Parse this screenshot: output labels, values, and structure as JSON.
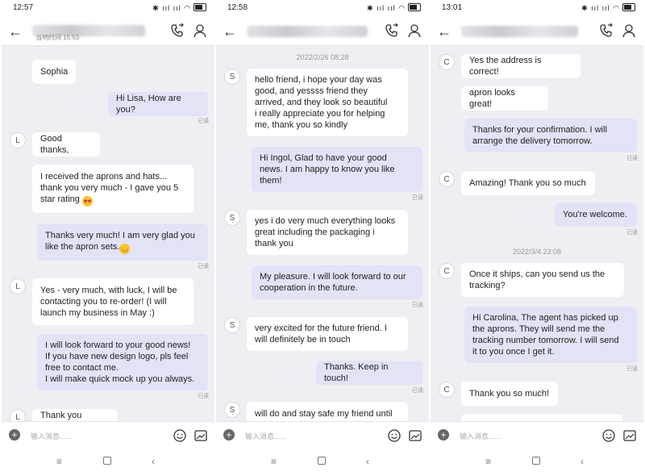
{
  "input_placeholder": "输入消息......",
  "read_label": "已读",
  "screens": [
    {
      "time": "12:57",
      "header_subtitle": "当地时间 15:53",
      "messages": [
        {
          "dir": "in",
          "text": "Sophia",
          "avatar": ""
        },
        {
          "dir": "out",
          "text": "Hi Lisa, How are you?",
          "read": true
        },
        {
          "dir": "in",
          "text": "Good thanks,",
          "avatar": "L"
        },
        {
          "dir": "in",
          "text": "I received the aprons and hats...\nthank you very much - I gave you 5\nstar rating",
          "emoji": "heart-eyes"
        },
        {
          "dir": "out",
          "text": "Thanks very much! I am very glad you\nlike the apron sets.",
          "emoji": "smile",
          "read": true
        },
        {
          "dir": "in",
          "text": "Yes - very much, with luck, I will be\ncontacting you to re-order! (I will\nlaunch my business in May :)",
          "avatar": "L"
        },
        {
          "dir": "out",
          "text": "I will look forward to your good news!\nIf you have new design logo, pls feel\nfree to contact me.\nI will make quick mock up you always.",
          "read": true
        },
        {
          "dir": "in",
          "text": "Thank you again!!",
          "avatar": "L"
        }
      ]
    },
    {
      "time": "12:58",
      "datetime": "2022/2/26 08:28",
      "messages": [
        {
          "dir": "in",
          "text": "hello friend, i hope your day was\ngood, and yessss friend they\narrived, and they look so beautiful\ni really appreciate you for helping\nme, thank you so kindly",
          "avatar": "S"
        },
        {
          "dir": "out",
          "text": "Hi Ingol, Glad to have your good\nnews. I am happy to know you like\nthem!",
          "read": true
        },
        {
          "dir": "in",
          "text": "yes i do very much everything looks\ngreat including the packaging i\nthank you",
          "avatar": "S"
        },
        {
          "dir": "out",
          "text": "My pleasure. I will look forward to our\ncooperation in the future.",
          "read": true
        },
        {
          "dir": "in",
          "text": "very excited for the future friend. I\nwill definitely be in touch",
          "avatar": "S"
        },
        {
          "dir": "out",
          "text": "Thanks. Keep in touch!",
          "read": true
        },
        {
          "dir": "in",
          "text": "will do and stay safe my friend until",
          "avatar": "S"
        }
      ]
    },
    {
      "time": "13:01",
      "datetime": "2022/3/4 23:08",
      "messages": [
        {
          "dir": "in",
          "text": "Yes the address is correct!",
          "avatar": "C"
        },
        {
          "dir": "in",
          "text": "apron looks great!"
        },
        {
          "dir": "out",
          "text": "Thanks for your confirmation. I will\narrange the delivery tomorrow.",
          "read": true
        },
        {
          "dir": "in",
          "text": "Amazing! Thank you so much",
          "avatar": "C"
        },
        {
          "dir": "out",
          "text": "You're welcome.",
          "read": true
        },
        {
          "dir": "in",
          "text": "Once it ships, can you send us the\ntracking?",
          "avatar": "C"
        },
        {
          "dir": "out",
          "text": "Hi Carolina, The agent has picked up\nthe aprons. They will send me the\ntracking number tomorrow. I will send\nit to you once I get it.",
          "read": true
        },
        {
          "dir": "in",
          "text": "Thank you so much!",
          "avatar": "C"
        }
      ]
    }
  ]
}
